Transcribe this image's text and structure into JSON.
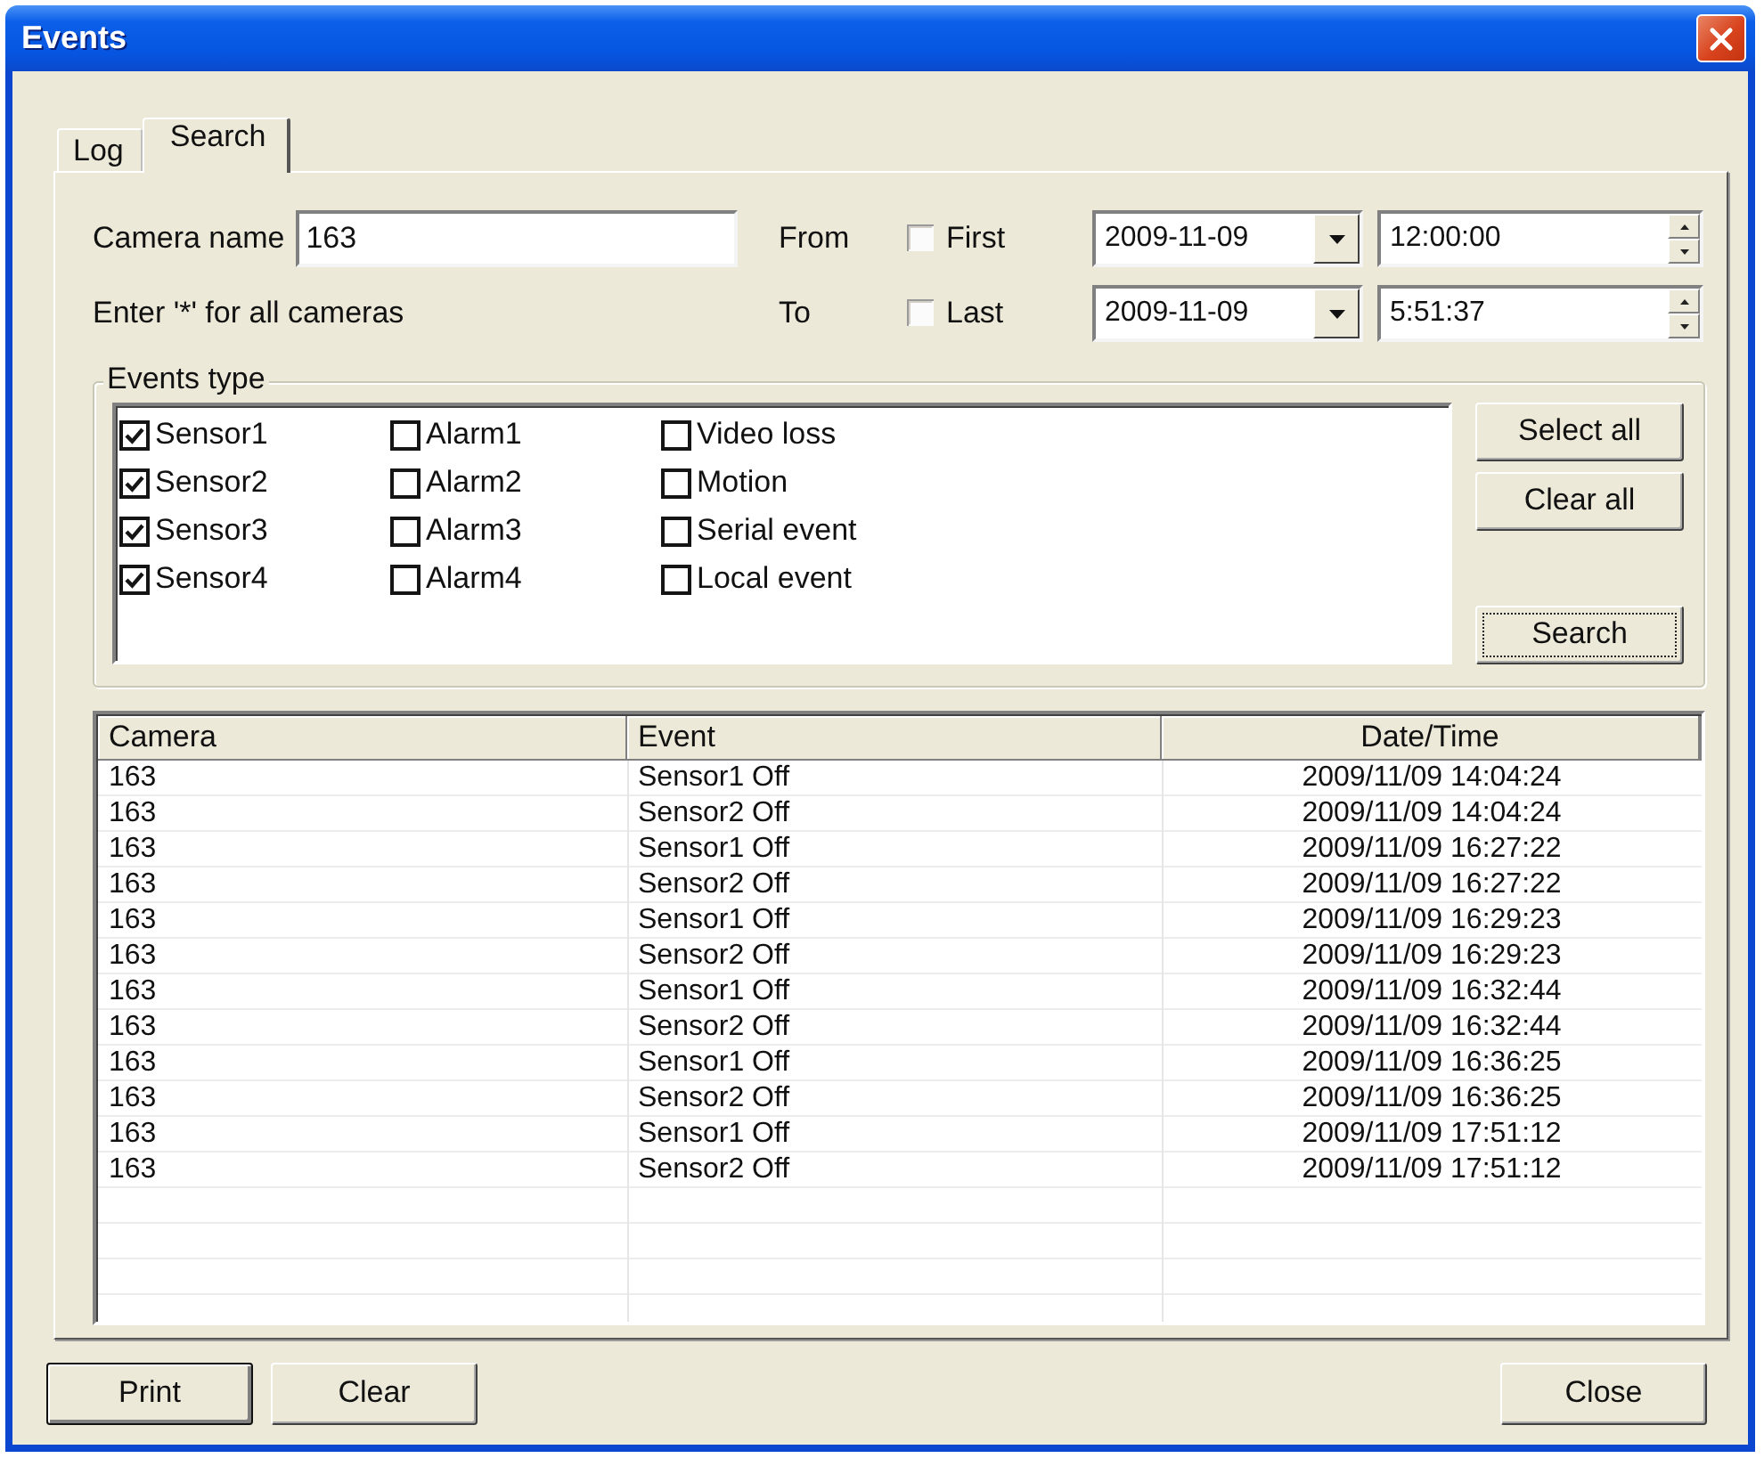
{
  "window": {
    "title": "Events"
  },
  "tabs": [
    {
      "label": "Log",
      "selected": false
    },
    {
      "label": "Search",
      "selected": true
    }
  ],
  "search_form": {
    "camera_name_label": "Camera name",
    "camera_name": "163",
    "hint": "Enter '*' for all cameras",
    "range": [
      {
        "label": "From",
        "option": "First",
        "checked": false,
        "date": "2009-11-09",
        "time": "12:00:00"
      },
      {
        "label": "To",
        "option": "Last",
        "checked": false,
        "date": "2009-11-09",
        "time": "5:51:37"
      }
    ]
  },
  "events_type": {
    "title": "Events type",
    "columns": [
      {
        "options": [
          {
            "label": "Sensor1",
            "checked": true
          },
          {
            "label": "Sensor2",
            "checked": true
          },
          {
            "label": "Sensor3",
            "checked": true
          },
          {
            "label": "Sensor4",
            "checked": true
          }
        ]
      },
      {
        "options": [
          {
            "label": "Alarm1",
            "checked": false
          },
          {
            "label": "Alarm2",
            "checked": false
          },
          {
            "label": "Alarm3",
            "checked": false
          },
          {
            "label": "Alarm4",
            "checked": false
          }
        ]
      },
      {
        "options": [
          {
            "label": "Video loss",
            "checked": false
          },
          {
            "label": "Motion",
            "checked": false
          },
          {
            "label": "Serial event",
            "checked": false
          },
          {
            "label": "Local event",
            "checked": false
          }
        ]
      }
    ],
    "buttons": [
      {
        "label": "Select all",
        "focused": false
      },
      {
        "label": "Clear all",
        "focused": false
      },
      {
        "label": "Search",
        "focused": true
      }
    ]
  },
  "table": {
    "columns": [
      "Camera",
      "Event",
      "Date/Time"
    ],
    "rows": [
      [
        "163",
        "Sensor1 Off",
        "2009/11/09 14:04:24"
      ],
      [
        "163",
        "Sensor2 Off",
        "2009/11/09 14:04:24"
      ],
      [
        "163",
        "Sensor1 Off",
        "2009/11/09 16:27:22"
      ],
      [
        "163",
        "Sensor2 Off",
        "2009/11/09 16:27:22"
      ],
      [
        "163",
        "Sensor1 Off",
        "2009/11/09 16:29:23"
      ],
      [
        "163",
        "Sensor2 Off",
        "2009/11/09 16:29:23"
      ],
      [
        "163",
        "Sensor1 Off",
        "2009/11/09 16:32:44"
      ],
      [
        "163",
        "Sensor2 Off",
        "2009/11/09 16:32:44"
      ],
      [
        "163",
        "Sensor1 Off",
        "2009/11/09 16:36:25"
      ],
      [
        "163",
        "Sensor2 Off",
        "2009/11/09 16:36:25"
      ],
      [
        "163",
        "Sensor1 Off",
        "2009/11/09 17:51:12"
      ],
      [
        "163",
        "Sensor2 Off",
        "2009/11/09 17:51:12"
      ]
    ]
  },
  "footer": {
    "left_buttons": [
      {
        "label": "Print",
        "default": true
      },
      {
        "label": "Clear",
        "default": false
      }
    ],
    "right_buttons": [
      {
        "label": "Close",
        "default": false
      }
    ]
  }
}
